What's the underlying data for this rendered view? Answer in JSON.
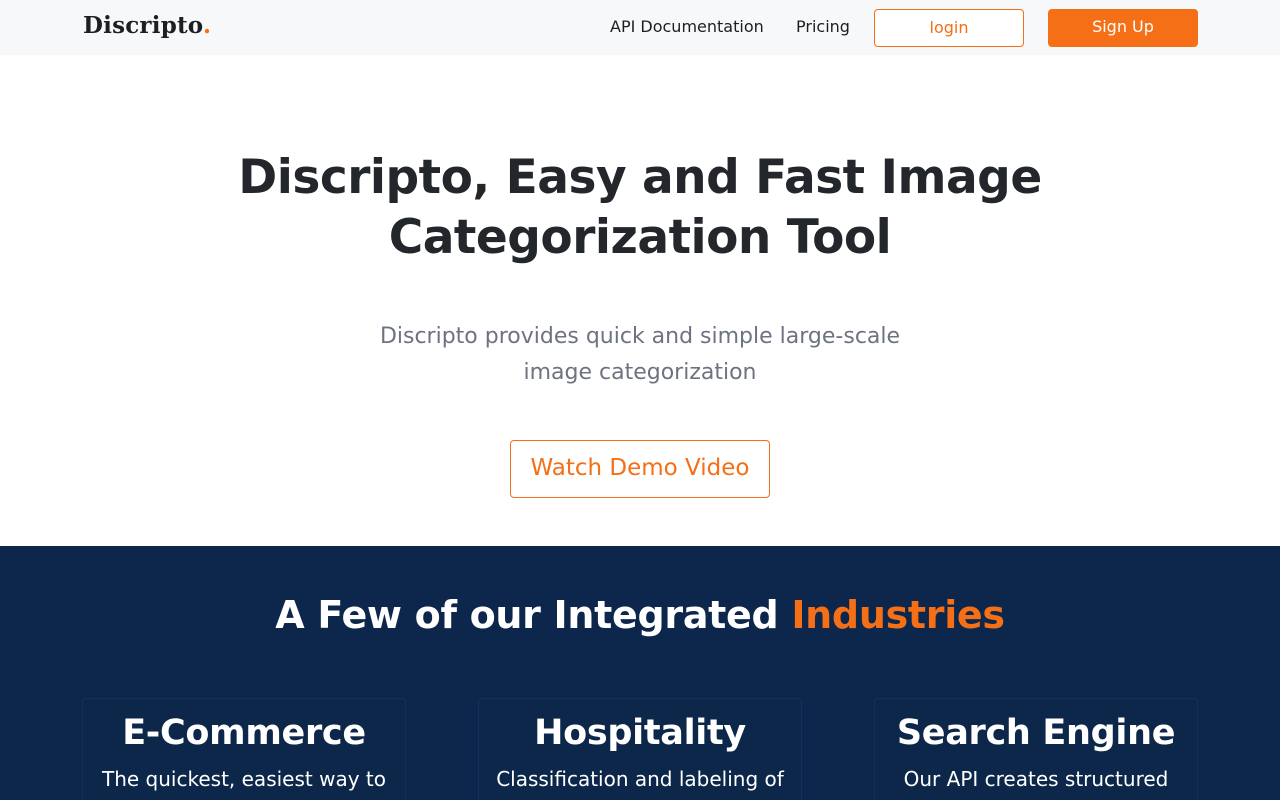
{
  "nav": {
    "logo_text": "Discripto",
    "logo_dot": ".",
    "links": [
      {
        "label": "API Documentation"
      },
      {
        "label": "Pricing"
      }
    ],
    "login_label": "login",
    "signup_label": "Sign Up"
  },
  "hero": {
    "title_line1": "Discripto, Easy and Fast Image",
    "title_line2": "Categorization Tool",
    "subtitle_line1": "Discripto provides quick and simple large-scale",
    "subtitle_line2": "image categorization",
    "demo_button": "Watch Demo Video"
  },
  "industries": {
    "title_prefix": "A Few of our Integrated ",
    "title_accent": "Industries",
    "cards": [
      {
        "title": "E-Commerce",
        "text": "The quickest, easiest way to"
      },
      {
        "title": "Hospitality",
        "text": "Classification and labeling of"
      },
      {
        "title": "Search Engine",
        "text": "Our API creates structured"
      }
    ]
  },
  "colors": {
    "accent": "#f46f16",
    "nav_background": "#f7f8fa",
    "industries_background": "#0c264c",
    "heading_text": "#23262b",
    "muted_text": "#6e7380"
  }
}
